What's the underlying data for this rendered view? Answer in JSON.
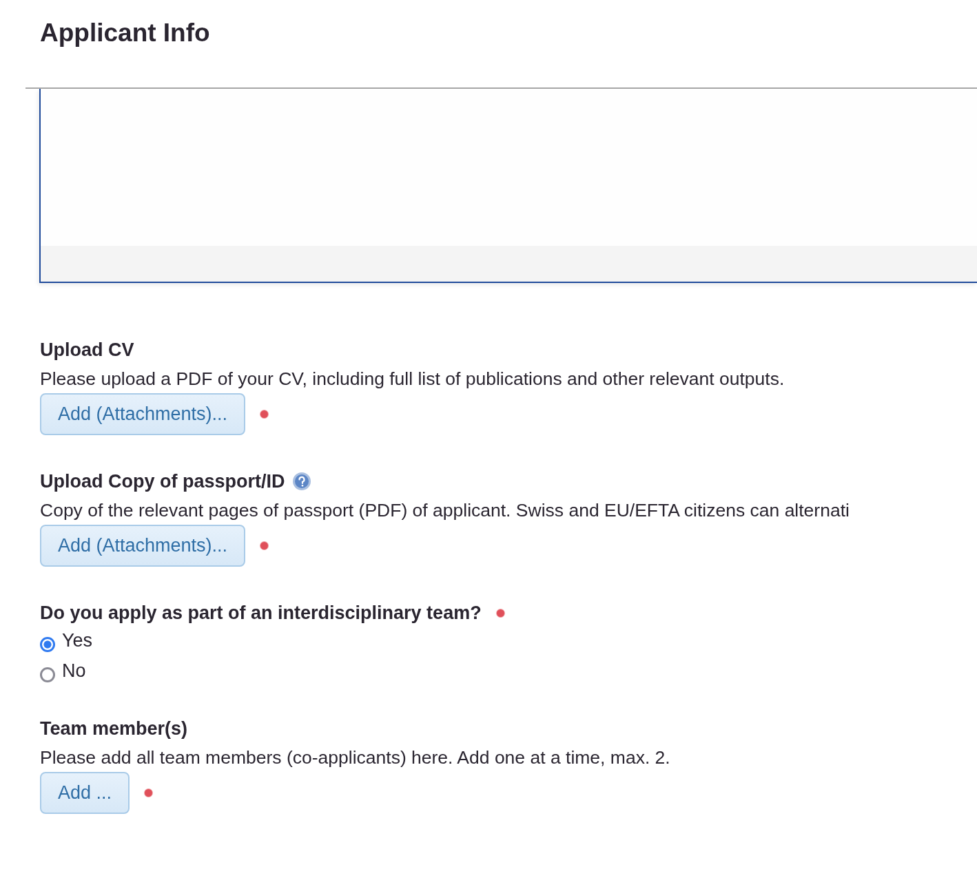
{
  "page_title": "Applicant Info",
  "sections": [
    {
      "kind": "upload",
      "label": "Upload CV",
      "help": false,
      "description": "Please upload a PDF of your CV, including full list of publications and other relevant outputs.",
      "button": "Add (Attachments)...",
      "required": true
    },
    {
      "kind": "upload",
      "label": "Upload Copy of passport/ID",
      "help": true,
      "description": "Copy of the relevant pages of passport (PDF) of applicant. Swiss and EU/EFTA citizens can alternati",
      "button": "Add (Attachments)...",
      "required": true
    },
    {
      "kind": "radio",
      "label": "Do you apply as part of an interdisciplinary team?",
      "help": false,
      "required": true,
      "options": [
        {
          "label": "Yes",
          "selected": true
        },
        {
          "label": "No",
          "selected": false
        }
      ]
    },
    {
      "kind": "upload",
      "label": "Team member(s)",
      "help": false,
      "description": "Please add all team members (co-applicants) here. Add one at a time, max. 2.",
      "button": "Add ...",
      "required": true
    }
  ]
}
